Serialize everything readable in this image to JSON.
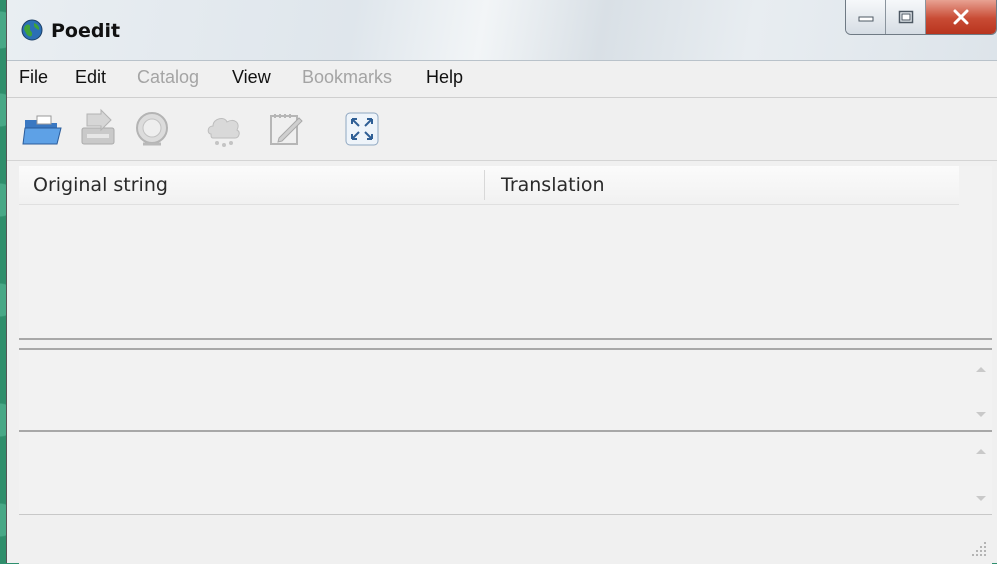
{
  "window": {
    "title": "Poedit",
    "icon": "globe-icon",
    "controls": [
      "minimize-icon",
      "maximize-icon",
      "close-icon"
    ]
  },
  "menu": {
    "items": [
      {
        "label": "File",
        "enabled": true
      },
      {
        "label": "Edit",
        "enabled": true
      },
      {
        "label": "Catalog",
        "enabled": false
      },
      {
        "label": "View",
        "enabled": true
      },
      {
        "label": "Bookmarks",
        "enabled": false
      },
      {
        "label": "Help",
        "enabled": true
      }
    ]
  },
  "toolbar": {
    "buttons": [
      {
        "icon": "open-folder-icon",
        "enabled": true
      },
      {
        "icon": "save-icon",
        "enabled": false
      },
      {
        "icon": "update-catalog-icon",
        "enabled": false
      },
      {
        "icon": "validate-icon",
        "enabled": false
      },
      {
        "icon": "edit-comment-icon",
        "enabled": false
      },
      {
        "icon": "fullscreen-icon",
        "enabled": true
      }
    ]
  },
  "list": {
    "columns": [
      "Original string",
      "Translation"
    ]
  },
  "colors": {
    "background": "#2f8e6b",
    "window": "#f0f0f0",
    "close_button": "#c84b34"
  }
}
